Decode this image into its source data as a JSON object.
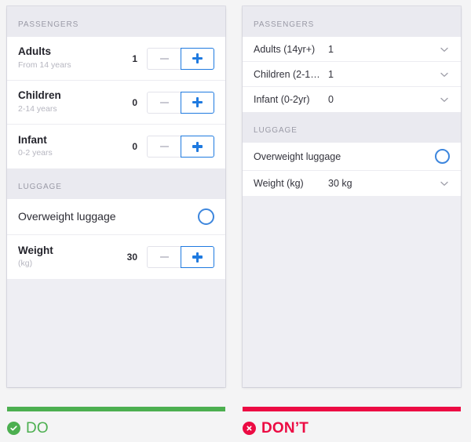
{
  "do_panel": {
    "sections": [
      {
        "header": "PASSENGERS",
        "rows": [
          {
            "title": "Adults",
            "subtitle": "From 14 years",
            "value": "1"
          },
          {
            "title": "Children",
            "subtitle": "2-14 years",
            "value": "0"
          },
          {
            "title": "Infant",
            "subtitle": "0-2 years",
            "value": "0"
          }
        ]
      },
      {
        "header": "LUGGAGE",
        "toggle_row": {
          "title": "Overweight luggage",
          "control": "radio-circle-unselected"
        },
        "rows": [
          {
            "title": "Weight",
            "subtitle": "(kg)",
            "value": "30"
          }
        ]
      }
    ],
    "stepper": {
      "minus_icon": "minus-icon",
      "plus_icon": "plus-icon"
    },
    "verdict": {
      "label": "DO",
      "icon": "check-circle-icon",
      "color": "#4caf50"
    }
  },
  "dont_panel": {
    "sections": [
      {
        "header": "PASSENGERS",
        "rows": [
          {
            "label": "Adults (14yr+)",
            "value": "1",
            "control": "chevron-down-icon"
          },
          {
            "label": "Children (2-1…",
            "value": "1",
            "control": "chevron-down-icon"
          },
          {
            "label": "Infant (0-2yr)",
            "value": "0",
            "control": "chevron-down-icon"
          }
        ]
      },
      {
        "header": "LUGGAGE",
        "toggle_row": {
          "label": "Overweight luggage",
          "control": "radio-circle-unselected"
        },
        "rows": [
          {
            "label": "Weight (kg)",
            "value": "30 kg",
            "control": "chevron-down-icon"
          }
        ]
      }
    ],
    "verdict": {
      "label": "DON’T",
      "icon": "x-circle-icon",
      "color": "#ec0b43"
    }
  },
  "colors": {
    "accent_blue": "#1f7ae0",
    "circle_blue": "#3d86dd",
    "do_green": "#4caf50",
    "dont_red": "#ec0b43",
    "page_background": "#f4f4f5",
    "panel_background": "#eeeef3",
    "section_header_text": "#9a9aa6"
  }
}
